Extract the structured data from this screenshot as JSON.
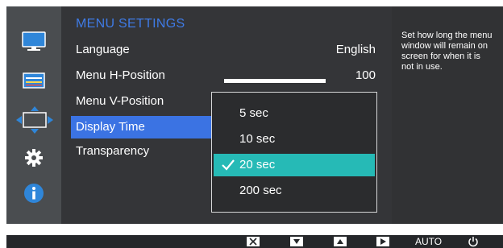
{
  "menu": {
    "title": "MENU SETTINGS",
    "items": [
      {
        "label": "Language",
        "value": "English"
      },
      {
        "label": "Menu H-Position",
        "value": "100",
        "level": 1.0
      },
      {
        "label": "Menu V-Position"
      },
      {
        "label": "Display Time"
      },
      {
        "label": "Transparency"
      }
    ],
    "selected_index": 3
  },
  "dropdown": {
    "options": [
      "5 sec",
      "10 sec",
      "20 sec",
      "200 sec"
    ],
    "selected": "20 sec"
  },
  "description": "Set how long the menu\nwindow will remain on\nscreen for when it is\nnot in use.",
  "sidebar": {
    "icons": [
      "monitor-icon",
      "picture-icon",
      "position-icon",
      "gear-icon",
      "info-icon"
    ],
    "active": "position-icon"
  },
  "bottom_bar": {
    "keys": [
      "close-icon",
      "down-icon",
      "up-icon",
      "enter-icon"
    ],
    "auto_label": "AUTO",
    "power_icon": "power-icon"
  },
  "colors": {
    "accent_blue": "#3b73e3",
    "title_blue": "#3f7be6",
    "selected_option": "#26bab6"
  }
}
